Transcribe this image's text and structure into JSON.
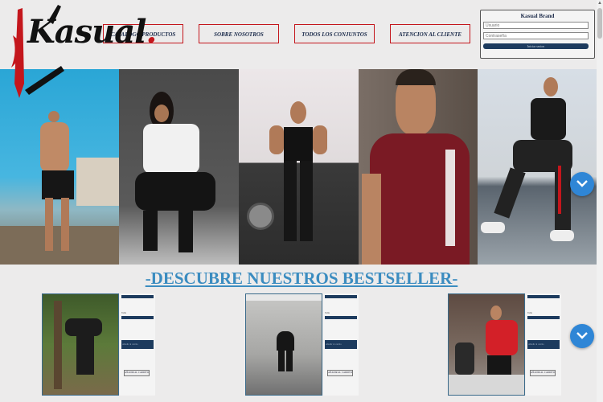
{
  "brand": {
    "logo_text": "Kasual",
    "logo_dot": "."
  },
  "nav": [
    {
      "label": "CATALOGO PRODUCTOS"
    },
    {
      "label": "SOBRE NOSOTROS"
    },
    {
      "label": "TODOS LOS CONJUNTOS"
    },
    {
      "label": "ATENCION AL CLIENTE"
    }
  ],
  "login": {
    "title": "Kasual Brand",
    "user_placeholder": "Usuario",
    "pass_placeholder": "Contraseña",
    "submit_label": "Iniciar sesion"
  },
  "bestseller": {
    "title": "-DESCUBRE NUESTROS BESTSELLER-"
  },
  "products": [
    {
      "mini_label": "Talla",
      "price_btn": "Añadir al carrito",
      "add_label": "AÑADIR AL CARRITO"
    },
    {
      "mini_label": "Talla",
      "price_btn": "Añadir al carrito",
      "add_label": "AÑADIR AL CARRITO"
    },
    {
      "mini_label": "Talla",
      "price_btn": "Añadir al carrito",
      "add_label": "AÑADIR AL CARRITO"
    }
  ],
  "colors": {
    "accent_red": "#c4161c",
    "navy": "#1d3b5e",
    "link_blue": "#3b8cc0",
    "fab_blue": "#2f86d6"
  },
  "icons": [
    "knife-logo-icon",
    "chevron-down-icon",
    "scroll-up-icon"
  ]
}
